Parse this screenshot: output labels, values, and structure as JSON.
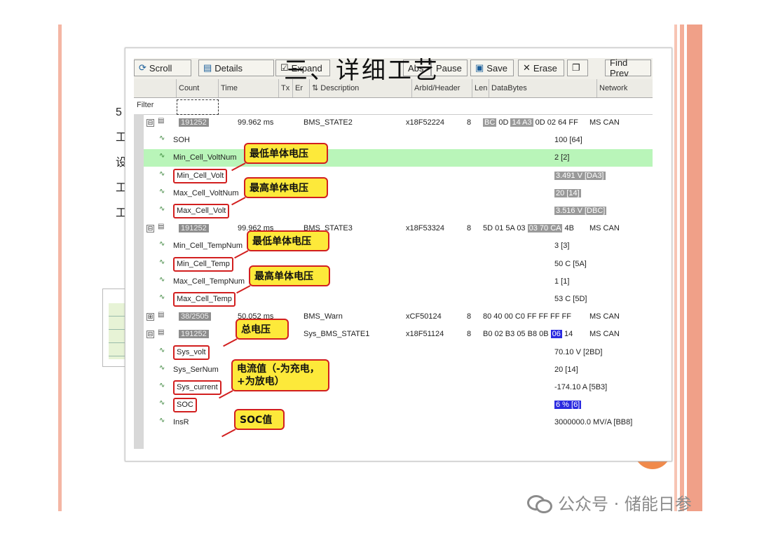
{
  "slide": {
    "title": "三、详细工艺",
    "side_chars": [
      "5",
      "工",
      "设",
      "工",
      "工"
    ],
    "watermark": "公众号 · 储能日参"
  },
  "toolbar": {
    "scroll": "Scroll",
    "details": "Details",
    "expand": "Expand",
    "abs": "Abs",
    "pause": "Pause",
    "save": "Save",
    "erase": "Erase",
    "find_prev": "Find Prev"
  },
  "columns": {
    "count": "Count",
    "time": "Time",
    "tx": "Tx",
    "er": "Er",
    "description": "Description",
    "arbid": "ArbId/Header",
    "len": "Len",
    "databytes": "DataBytes",
    "network": "Network"
  },
  "filter_label": "Filter",
  "rows": [
    {
      "type": "msg",
      "toggle": "⊟",
      "count": "191252",
      "time": "99.962 ms",
      "desc": "BMS_STATE2",
      "arbid": "x18F52224",
      "len": "8",
      "data_pre": "",
      "data_sel": "BC",
      "data_mid": " 0D ",
      "data_sel2": "14 A3",
      "data_post": " 0D 02 64 FF",
      "network": "MS CAN"
    },
    {
      "type": "sig",
      "name": "SOH",
      "boxed": false,
      "value": "100  [64]",
      "vstyle": ""
    },
    {
      "type": "sig",
      "name": "Min_Cell_VoltNum",
      "boxed": false,
      "value": "2  [2]",
      "vstyle": "",
      "hl": true
    },
    {
      "type": "sig",
      "name": "Min_Cell_Volt",
      "boxed": true,
      "value": "3.491 V  [DA3]",
      "vstyle": "sel"
    },
    {
      "type": "sig",
      "name": "Max_Cell_VoltNum",
      "boxed": false,
      "value": "20  [14]",
      "vstyle": "sel"
    },
    {
      "type": "sig",
      "name": "Max_Cell_Volt",
      "boxed": true,
      "value": "3.516 V  [DBC]",
      "vstyle": "sel"
    },
    {
      "type": "msg",
      "toggle": "⊟",
      "count": "191252",
      "time": "99.962 ms",
      "desc": "BMS_STATE3",
      "arbid": "x18F53324",
      "len": "8",
      "data_pre": "5D 01 5A 03 ",
      "data_sel": "",
      "data_mid": "",
      "data_sel2": "03 70 CA",
      "data_post": " 4B",
      "network": "MS CAN"
    },
    {
      "type": "sig",
      "name": "Min_Cell_TempNum",
      "boxed": false,
      "value": "3  [3]",
      "vstyle": ""
    },
    {
      "type": "sig",
      "name": "Min_Cell_Temp",
      "boxed": true,
      "value": "50 C  [5A]",
      "vstyle": ""
    },
    {
      "type": "sig",
      "name": "Max_Cell_TempNum",
      "boxed": false,
      "value": "1  [1]",
      "vstyle": ""
    },
    {
      "type": "sig",
      "name": "Max_Cell_Temp",
      "boxed": true,
      "value": "53 C  [5D]",
      "vstyle": ""
    },
    {
      "type": "msg",
      "toggle": "⊞",
      "count": "38/2505",
      "time": "50.052 ms",
      "desc": "BMS_Warn",
      "arbid": "xCF50124",
      "len": "8",
      "data_pre": "80 40 00 C0 FF FF FF FF",
      "data_sel": "",
      "data_mid": "",
      "data_sel2": "",
      "data_post": "",
      "network": "MS CAN"
    },
    {
      "type": "msg",
      "toggle": "⊟",
      "count": "191252",
      "time": "",
      "desc": "Sys_BMS_STATE1",
      "arbid": "x18F51124",
      "len": "8",
      "data_pre": "B0 02 B3 05 B8 0B ",
      "data_sel": "",
      "data_mid": "",
      "data_sel2": "",
      "data_blue": "06",
      "data_post": " 14",
      "network": "MS CAN"
    },
    {
      "type": "sig",
      "name": "Sys_volt",
      "boxed": true,
      "value": "70.10 V  [2BD]",
      "vstyle": ""
    },
    {
      "type": "sig",
      "name": "Sys_SerNum",
      "boxed": false,
      "value": "20  [14]",
      "vstyle": ""
    },
    {
      "type": "sig",
      "name": "Sys_current",
      "boxed": true,
      "value": "-174.10 A  [5B3]",
      "vstyle": ""
    },
    {
      "type": "sig",
      "name": "SOC",
      "boxed": true,
      "value": "6 %  [6]",
      "vstyle": "selb"
    },
    {
      "type": "sig",
      "name": "InsR",
      "boxed": false,
      "value": "3000000.0 MV/A  [BB8]",
      "vstyle": ""
    }
  ],
  "callouts": {
    "min_volt": "最低单体电压",
    "max_volt": "最高单体电压",
    "min_temp": "最低单体电压",
    "max_temp": "最高单体电压",
    "total_volt": "总电压",
    "current_line1": "电流值（-为充电，",
    "current_line2": "+为放电）",
    "soc": "SOC值"
  }
}
